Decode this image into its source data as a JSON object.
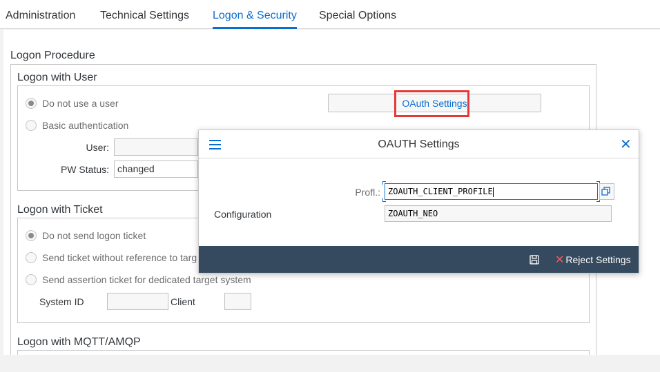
{
  "tabs": [
    {
      "label": "Administration"
    },
    {
      "label": "Technical Settings"
    },
    {
      "label": "Logon & Security",
      "active": true
    },
    {
      "label": "Special Options"
    }
  ],
  "logon_procedure": {
    "title": "Logon Procedure",
    "logon_with_user": {
      "title": "Logon with User",
      "radios": [
        {
          "label": "Do not use a user",
          "checked": true
        },
        {
          "label": "Basic authentication",
          "checked": false
        }
      ],
      "user_label": "User:",
      "user_value": "",
      "pw_status_label": "PW Status:",
      "pw_status_value": "changed",
      "oauth_button": "OAuth Settings"
    },
    "logon_with_ticket": {
      "title": "Logon with Ticket",
      "radios": [
        {
          "label": "Do not send logon ticket",
          "checked": true
        },
        {
          "label": "Send ticket without reference to targ",
          "checked": false
        },
        {
          "label": "Send assertion ticket for dedicated target system",
          "checked": false
        }
      ],
      "system_id_label": "System ID",
      "client_label": "Client"
    },
    "logon_with_mqtt": {
      "title": "Logon with MQTT/AMQP"
    }
  },
  "dialog": {
    "title": "OAUTH Settings",
    "profile_label": "Profl.:",
    "profile_value": "ZOAUTH_CLIENT_PROFILE",
    "configuration_label": "Configuration",
    "configuration_value": "ZOAUTH_NEO",
    "reject_label": "Reject Settings",
    "icons": [
      "menu-icon",
      "close-icon",
      "value-help-icon",
      "save-icon",
      "reject-icon"
    ]
  },
  "colors": {
    "accent": "#0a6ed1",
    "footer": "#354a5f",
    "highlight": "#e53935",
    "reject": "#ff5a5a"
  }
}
